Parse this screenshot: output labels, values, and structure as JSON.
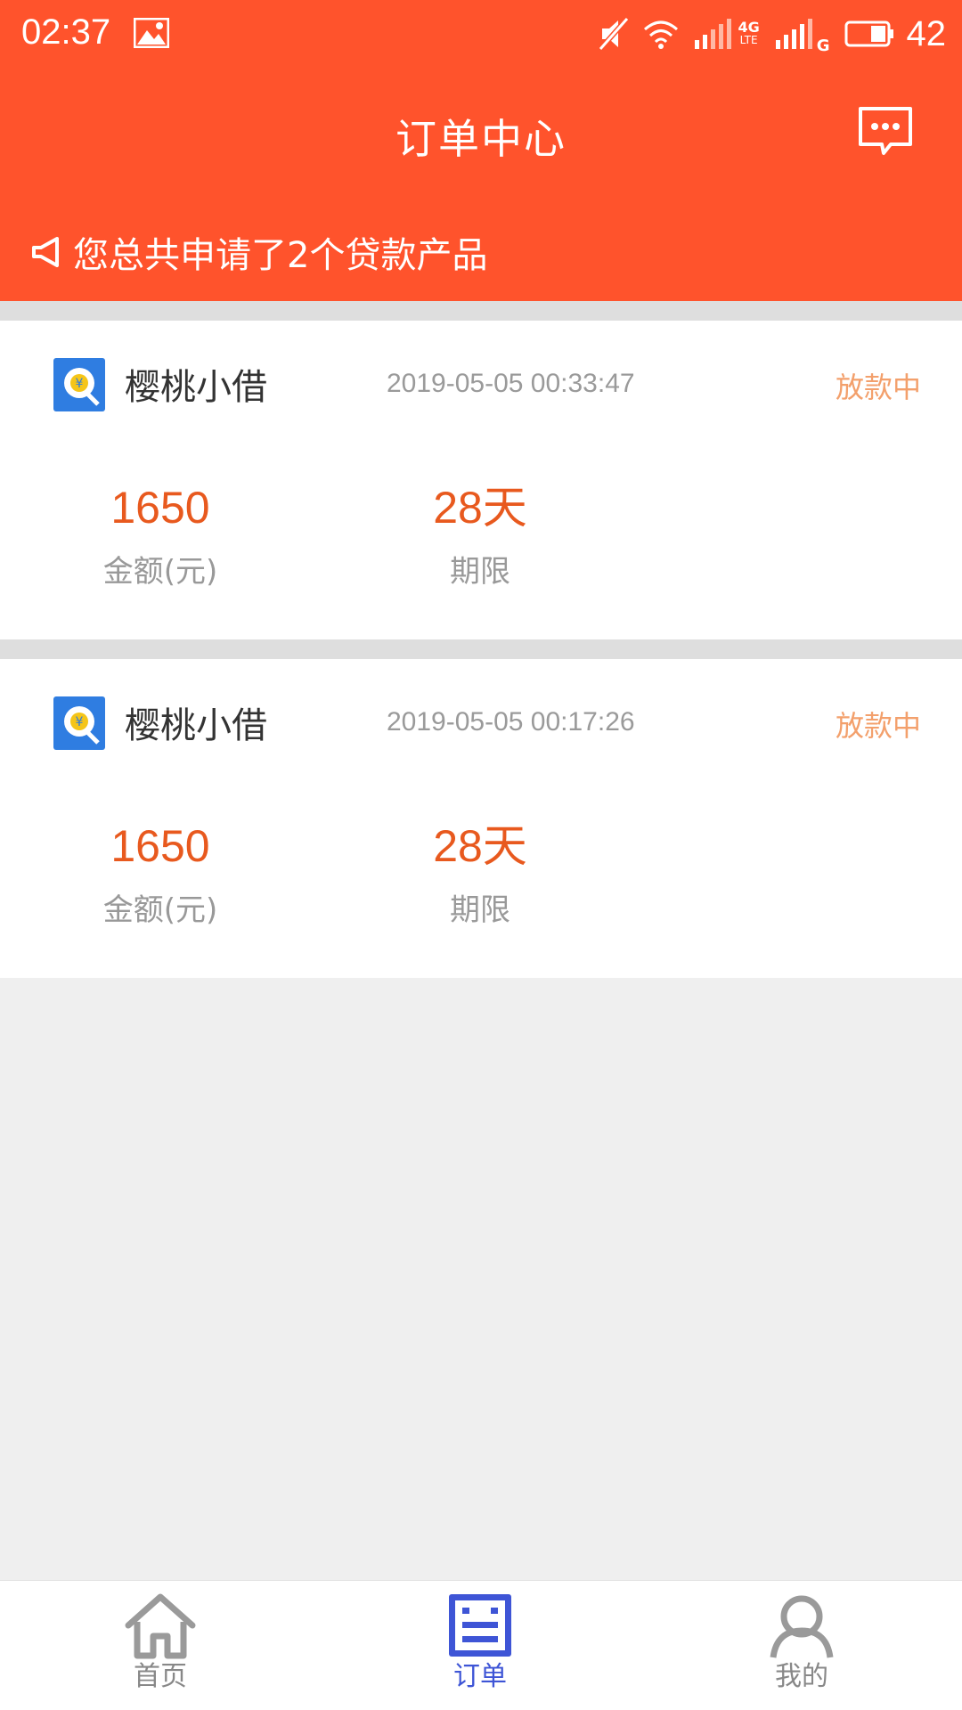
{
  "status_bar": {
    "time": "02:37",
    "network_4g": "4G",
    "network_lte": "LTE",
    "network_g": "G",
    "battery": "42"
  },
  "header": {
    "title": "订单中心",
    "notice": "您总共申请了2个贷款产品",
    "bg_color": "#ff532c"
  },
  "orders": [
    {
      "name": "樱桃小借",
      "time": "2019-05-05 00:33:47",
      "status": "放款中",
      "amount": "1650",
      "amount_label": "金额(元)",
      "term": "28天",
      "term_label": "期限"
    },
    {
      "name": "樱桃小借",
      "time": "2019-05-05 00:17:26",
      "status": "放款中",
      "amount": "1650",
      "amount_label": "金额(元)",
      "term": "28天",
      "term_label": "期限"
    }
  ],
  "tabs": [
    {
      "label": "首页",
      "icon": "home-icon",
      "active": false
    },
    {
      "label": "订单",
      "icon": "order-icon",
      "active": true
    },
    {
      "label": "我的",
      "icon": "user-icon",
      "active": false
    }
  ],
  "colors": {
    "accent": "#ff532c",
    "amount": "#e8591e",
    "status": "#f3a06c",
    "tab_active": "#3e55d6"
  }
}
